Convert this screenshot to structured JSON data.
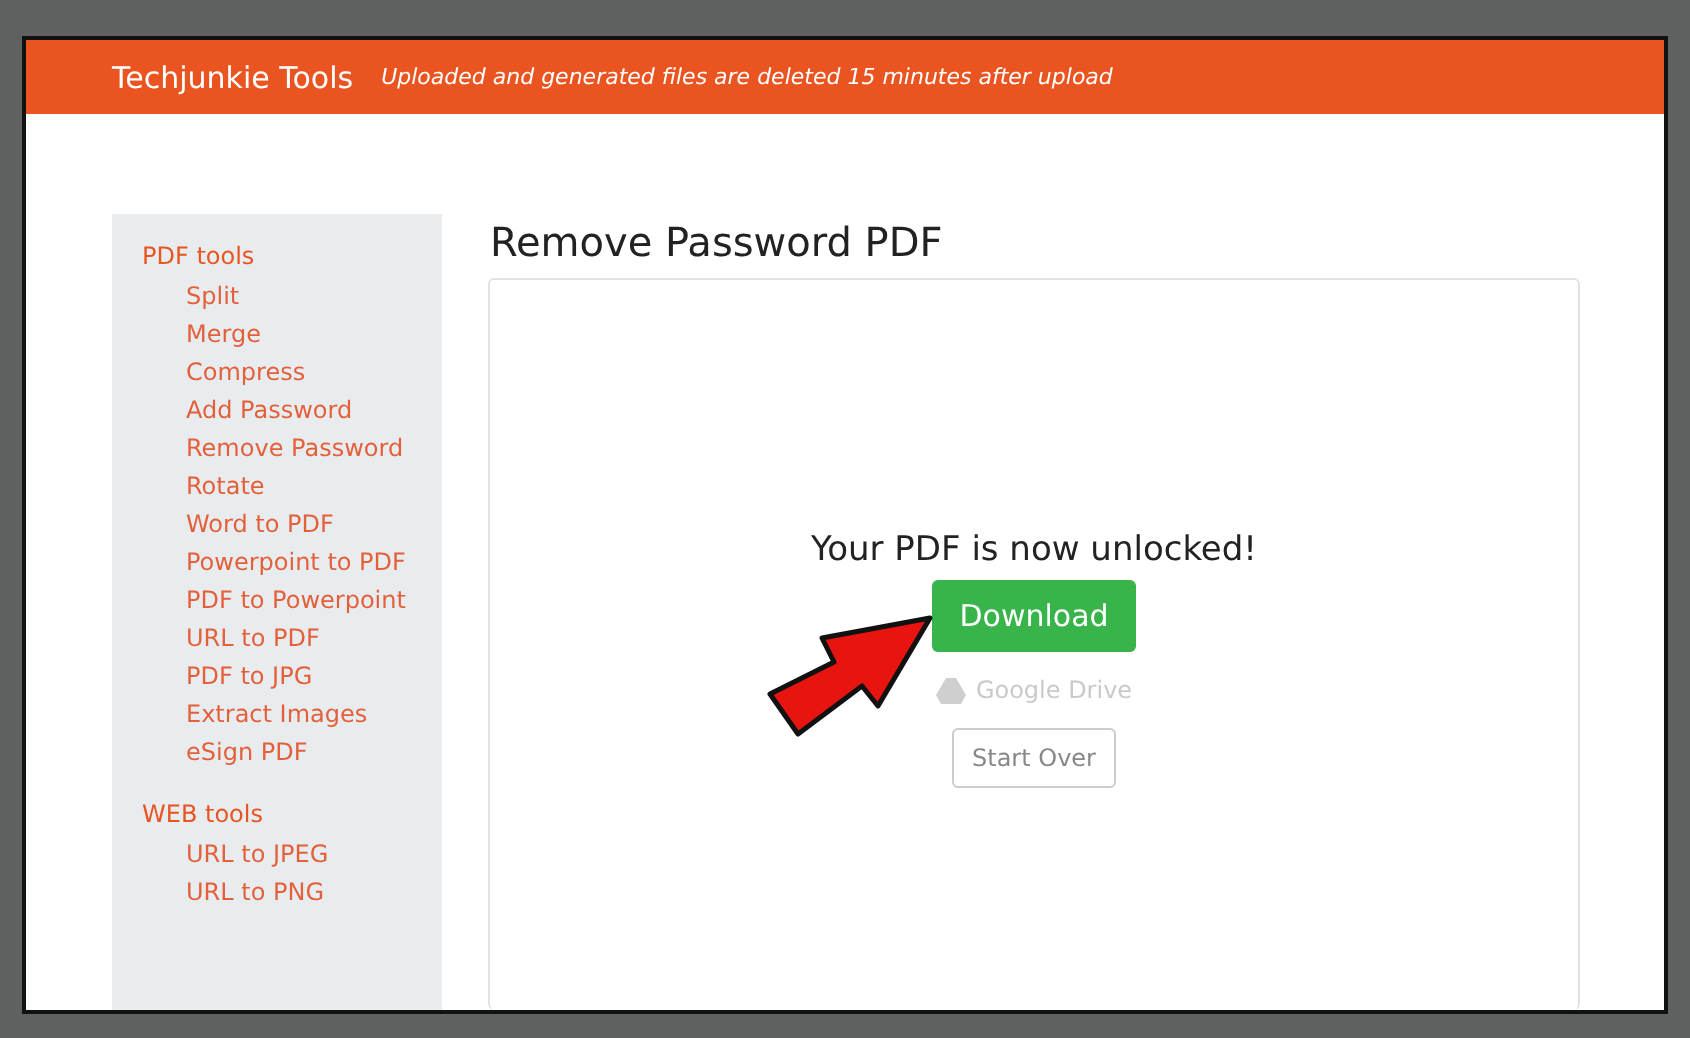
{
  "header": {
    "brand": "Techjunkie Tools",
    "notice": "Uploaded and generated files are deleted 15 minutes after upload"
  },
  "sidebar": {
    "sections": [
      {
        "title": "PDF tools",
        "items": [
          "Split",
          "Merge",
          "Compress",
          "Add Password",
          "Remove Password",
          "Rotate",
          "Word to PDF",
          "Powerpoint to PDF",
          "PDF to Powerpoint",
          "URL to PDF",
          "PDF to JPG",
          "Extract Images",
          "eSign PDF"
        ]
      },
      {
        "title": "WEB tools",
        "items": [
          "URL to JPEG",
          "URL to PNG"
        ]
      }
    ]
  },
  "main": {
    "title": "Remove Password PDF",
    "message": "Your PDF is now unlocked!",
    "download": "Download",
    "drive": "Google Drive",
    "start_over": "Start Over"
  }
}
